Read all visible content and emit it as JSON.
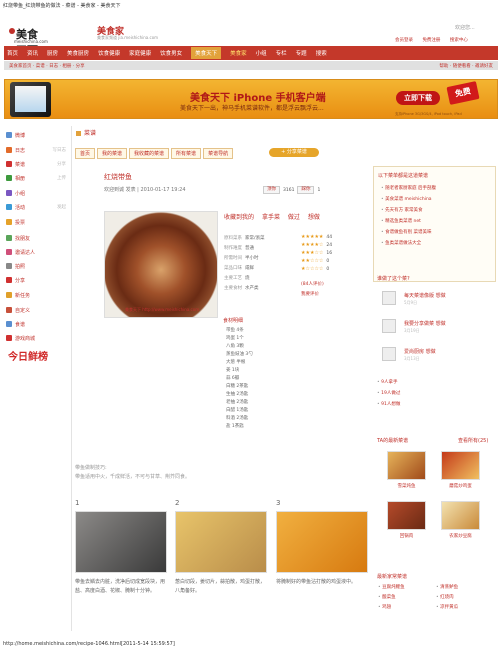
{
  "page_title": "红烧带鱼_红烧带鱼的做法 - 菜谱 - 美食家 - 美食天下",
  "footer_url": "http://home.meishichina.com/recipe-1046.html[2011-5-14 15:59:57]",
  "header": {
    "logo_cn": "美食天下",
    "logo_en": "meishichina.com",
    "site_name": "美食家",
    "site_sub": "美食家频道 jia.meishichina.com",
    "welcome": "欢迎您...",
    "links": [
      "会员登录",
      "免费注册",
      "搜索中心"
    ]
  },
  "nav": {
    "items": [
      "首页",
      "资讯",
      "厨房",
      "美食厨房",
      "饮食健康",
      "家庭健康",
      "饮食男女",
      "美食天下",
      "美食家",
      "小组",
      "专栏",
      "专题",
      "搜索"
    ],
    "active_index": 7,
    "gold_index": 8
  },
  "subnav": {
    "left": "美食家首页 · 菜谱 · 日志 · 相册 · 分享",
    "right": "帮助 · 随便看看 · 邀请好友"
  },
  "banner": {
    "title": "美食天下 iPhone 手机客户端",
    "subtitle": "美食天下一出，神马手机菜谱软件，都是浮云飘浮云...",
    "button": "立即下载",
    "tag": "免费",
    "foot": "支持iPhone 3G/3GS/4, iPod touch, iPad"
  },
  "sidebar": {
    "items": [
      {
        "label": "微博",
        "extra": "",
        "color": "#5a8fd0"
      },
      {
        "label": "日志",
        "extra": "写日志",
        "color": "#e26b2a"
      },
      {
        "label": "菜谱",
        "extra": "分享",
        "color": "#d03030"
      },
      {
        "label": "相册",
        "extra": "上传",
        "color": "#3d9a3d"
      },
      {
        "label": "小组",
        "extra": "",
        "color": "#7a57c2"
      },
      {
        "label": "活动",
        "extra": "发起",
        "color": "#3a9ad6"
      },
      {
        "label": "投票",
        "extra": "",
        "color": "#e5a22a"
      },
      {
        "label": "找朋友",
        "extra": "",
        "color": "#5aa55a"
      },
      {
        "label": "邀请达人",
        "extra": "",
        "color": "#d04f7a"
      },
      {
        "label": "拍照",
        "extra": "",
        "color": "#888"
      },
      {
        "label": "分享",
        "extra": "",
        "color": "#d03030"
      },
      {
        "label": "新任务",
        "extra": "",
        "color": "#e0a02a"
      },
      {
        "label": "自定义",
        "extra": "",
        "color": "#c7503a"
      },
      {
        "label": "食谱",
        "extra": "",
        "color": "#5a8fd0"
      },
      {
        "label": "游戏商城",
        "extra": "",
        "color": "#d03030"
      }
    ],
    "badge": "今日鲜榜"
  },
  "section": {
    "title": "菜谱"
  },
  "tabs": [
    "首页",
    "我的菜谱",
    "我收藏的菜谱",
    "所有菜谱",
    "菜谱导航"
  ],
  "tab_cta": "+ 分享菜谱",
  "recipe": {
    "title": "红烧带鱼",
    "author_line": "欢迎到诚 发表 | 2010-01-17 19:24",
    "vote_good": "顶你",
    "vote_good_count": "3161",
    "vote_bad": "踩你",
    "vote_bad_count": "1",
    "actions": [
      "收藏到我的",
      "拿手菜",
      "做过",
      "想做"
    ],
    "image_caption": "美食天下 http://www.meishichina.com",
    "props": [
      {
        "k": "原料菜系",
        "v": "家常/浙菜"
      },
      {
        "k": "制作难度",
        "v": "普通"
      },
      {
        "k": "所需时间",
        "v": "半小时"
      },
      {
        "k": "菜品口味",
        "v": "咸鲜"
      },
      {
        "k": "主要工艺",
        "v": "烧"
      },
      {
        "k": "主要食材",
        "v": "水产类"
      }
    ],
    "ratings": [
      "44",
      "24",
      "16",
      "0",
      "0"
    ],
    "review_count": "(84人评价)",
    "review_link": "我要评价",
    "ingredients_title": "食材明细",
    "ingredients": [
      "带鱼 4条",
      "鸡蛋 1个",
      "八角 3颗",
      "蒸鱼豉油 3勺",
      "大葱 半根",
      "姜 1块",
      "蒜 6瓣",
      "白糖 2茶匙",
      "生抽 2汤匙",
      "老抽 2汤匙",
      "白醋 1汤匙",
      "料酒 2汤匙",
      "盐 1茶匙"
    ],
    "tips_title": "带鱼做制技巧:",
    "tips": "带鱼适用中火，千成鲜活，不可与甘草、荆芥同食。",
    "steps": [
      {
        "num": "1",
        "text": "带鱼去鳞去内脏，洗净后切成宽段块，用盐、高度白酒、花椒、腌制十分钟。"
      },
      {
        "num": "2",
        "text": "葱白切段，姜切片，蒜拍散，鸡蛋打散，八角备好。"
      },
      {
        "num": "3",
        "text": "将腌制好的带鱼沾打散的鸡蛋液中。"
      }
    ]
  },
  "right": {
    "box1_title": "以下菜单都是这道菜谱",
    "box1_items": [
      "随老者家厨家庭 后手剖腹",
      "美食菜谱 meishichina",
      "先天有方 家常美食",
      "精选鱼类菜谱 net",
      "食谱做鱼有别 菜谱美味",
      "鱼类菜谱做法大全"
    ],
    "box2_title": "谁做了这个菜?",
    "cooks": [
      {
        "name": "每天菜谱像版 想做",
        "date": "5月9日"
      },
      {
        "name": "我要分享做菜 想做",
        "date": "3月19日"
      },
      {
        "name": "爱尚厨房 想做",
        "date": "3月13日"
      }
    ],
    "stats": [
      "9人拿手",
      "19人做过",
      "91人想做"
    ],
    "box3_title": "TA的最新菜谱",
    "box3_more": "查看所有(25)",
    "thumbs": [
      "雪菜炖鱼",
      "蘑菇炒鸡蛋",
      "回锅肉",
      "农家炒豆腐"
    ],
    "box4_title": "最新家常菜谱",
    "box4_items": [
      "豆腐炖鲤鱼",
      "清蒸鲈鱼",
      "酸菜鱼",
      "红烧肉",
      "鸡翅",
      "凉拌黄瓜"
    ]
  },
  "colors": {
    "brand": "#c0302a",
    "accent": "#e2a23b",
    "nav": "#c4382a"
  }
}
